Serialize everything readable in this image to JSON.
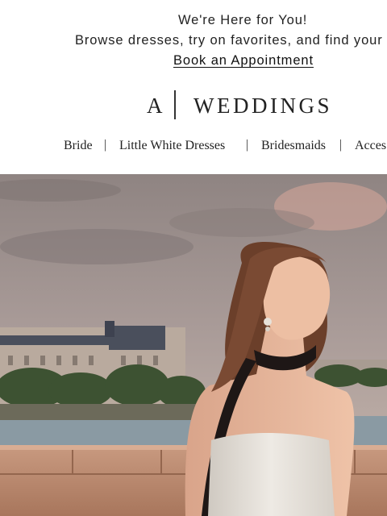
{
  "announcement": {
    "headline": "We're Here for You!",
    "subline": "Browse dresses, try on favorites, and find your lo",
    "cta_label": "Book an Appointment"
  },
  "brand": {
    "left": "A",
    "right": "WEDDINGS"
  },
  "nav": {
    "items": [
      "Bride",
      "Little White Dresses",
      "Bridesmaids",
      "Acces"
    ],
    "separator": "|"
  },
  "hero": {
    "image_icon": "bride-paris-photo",
    "colors": {
      "sky": "#9a8f8c",
      "wall": "#c4957a",
      "dress": "#e6e1da",
      "hair": "#6b3f2a"
    }
  }
}
